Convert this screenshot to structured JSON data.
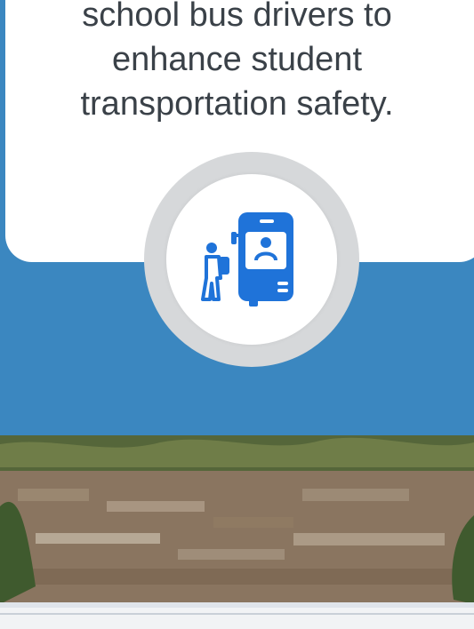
{
  "hero": {
    "heading_lines": [
      "school bus drivers to",
      "enhance student",
      "transportation safety."
    ]
  },
  "icons": {
    "badge": "student-boarding-bus-icon",
    "accent": "#1f73d9"
  },
  "colors": {
    "background": "#3b87c0",
    "card": "#ffffff",
    "ring": "#d6d8da",
    "text": "#3a4148"
  }
}
